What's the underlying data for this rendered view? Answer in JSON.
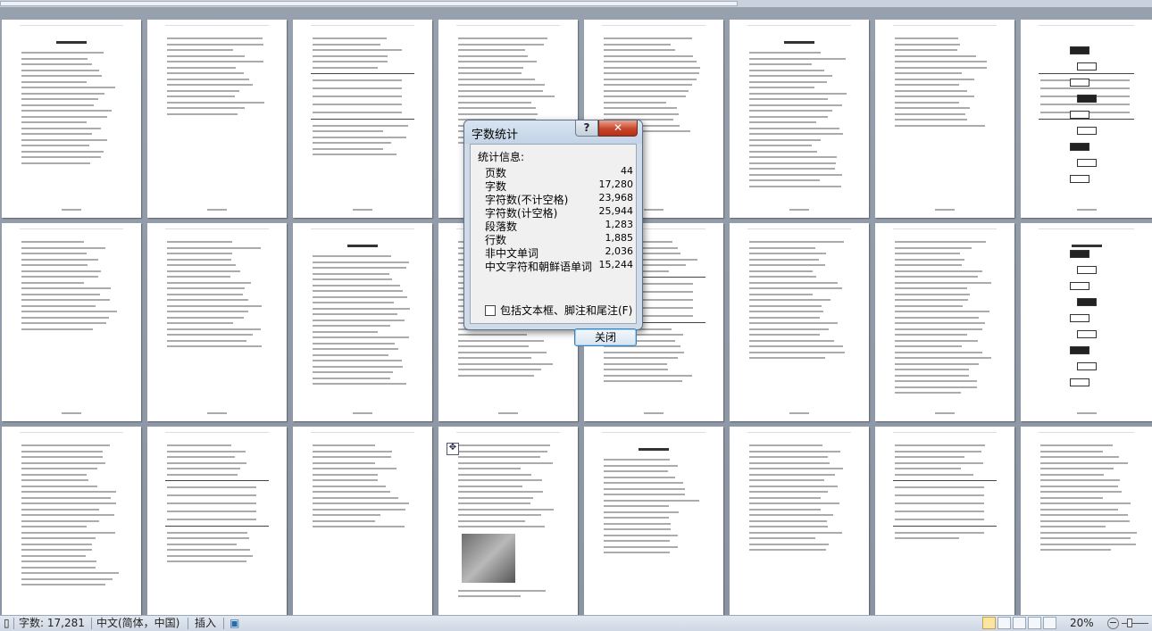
{
  "dialog": {
    "title": "字数统计",
    "section_label": "统计信息:",
    "help_label": "?",
    "close_label": "✕",
    "stats": [
      {
        "label": "页数",
        "value": "44"
      },
      {
        "label": "字数",
        "value": "17,280"
      },
      {
        "label": "字符数(不计空格)",
        "value": "23,968"
      },
      {
        "label": "字符数(计空格)",
        "value": "25,944"
      },
      {
        "label": "段落数",
        "value": "1,283"
      },
      {
        "label": "行数",
        "value": "1,885"
      },
      {
        "label": "非中文单词",
        "value": "2,036"
      },
      {
        "label": "中文字符和朝鲜语单词",
        "value": "15,244"
      }
    ],
    "checkbox_label": "包括文本框、脚注和尾注(F)",
    "checkbox_checked": false,
    "close_button_label": "关闭",
    "highlight_color": "#e03333"
  },
  "statusbar": {
    "word_count": "字数: 17,281",
    "language": "中文(简体，中国)",
    "mode": "插入",
    "zoom": "20%"
  },
  "icons": {
    "move_handle": "move-handle-icon",
    "macro": "macro-record-icon"
  }
}
